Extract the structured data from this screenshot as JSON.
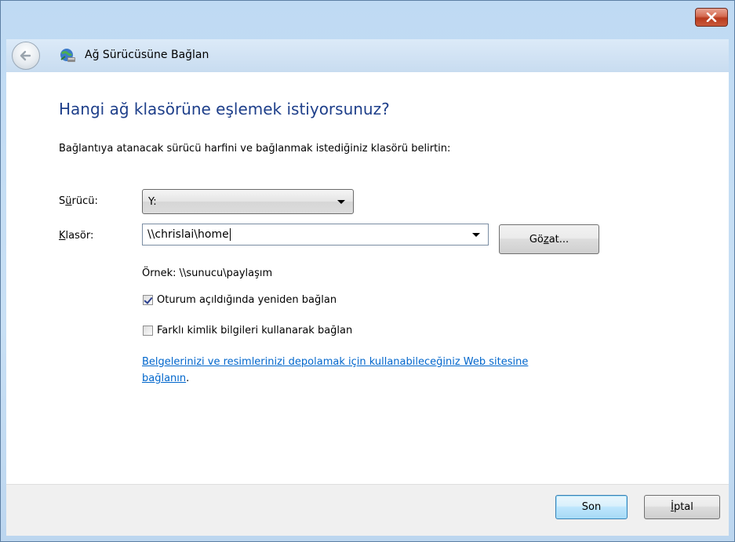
{
  "window": {
    "title": "Ağ Sürücüsüne Bağlan",
    "close_icon": "close-x-icon",
    "back_icon": "back-arrow-icon",
    "title_icon": "network-drive-icon"
  },
  "main": {
    "heading": "Hangi ağ klasörüne eşlemek istiyorsunuz?",
    "instruction": "Bağlantıya atanacak sürücü harfini ve bağlanmak istediğiniz klasörü belirtin:",
    "drive": {
      "label_pre": "S",
      "label_key": "ü",
      "label_post": "rücü:",
      "value": "Y:"
    },
    "folder": {
      "label_key": "K",
      "label_post": "lasör:",
      "value": "\\\\chrislai\\home"
    },
    "browse": {
      "label_pre": "Gö",
      "label_key": "z",
      "label_post": "at..."
    },
    "example": "Örnek: \\\\sunucu\\paylaşım",
    "reconnect": {
      "label": "Oturum açıldığında yeniden bağlan",
      "checked": true
    },
    "different_credentials": {
      "label": "Farklı kimlik bilgileri kullanarak bağlan",
      "checked": false
    },
    "link": {
      "line1": "Belgelerinizi ve resimlerinizi depolamak için kullanabileceğiniz Web sitesine",
      "line2": "bağlanın",
      "suffix": "."
    }
  },
  "footer": {
    "finish": "Son",
    "cancel_key": "İ",
    "cancel_post": "ptal"
  },
  "colors": {
    "heading": "#1e3f8a",
    "link": "#0066cc",
    "frame": "#c9e0f5",
    "close_button": "#c9593a"
  }
}
